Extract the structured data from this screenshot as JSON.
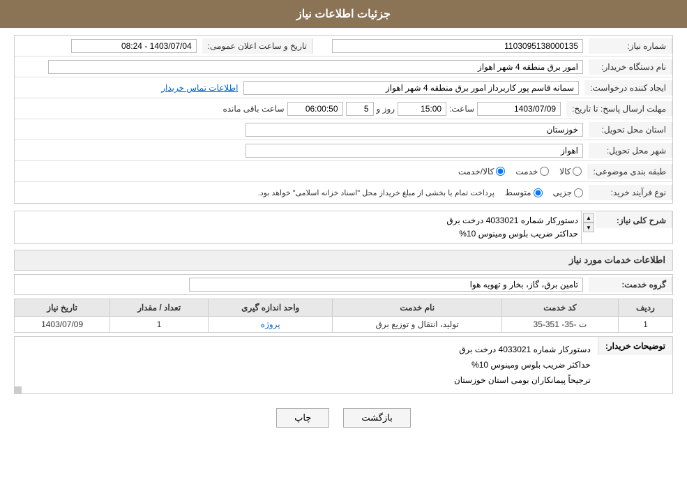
{
  "header": {
    "title": "جزئیات اطلاعات نیاز"
  },
  "form": {
    "need_number_label": "شماره نیاز:",
    "need_number_value": "1103095138000135",
    "buyer_org_label": "نام دستگاه خریدار:",
    "buyer_org_value": "امور برق منطقه 4 شهر اهواز",
    "creator_label": "ایجاد کننده درخواست:",
    "creator_value": "سمانه قاسم پور کاربرداز امور برق منطقه 4 شهر اهواز",
    "creator_link": "اطلاعات تماس خریدار",
    "deadline_label": "مهلت ارسال پاسخ: تا تاریخ:",
    "deadline_date": "1403/07/09",
    "deadline_time_label": "ساعت:",
    "deadline_time": "15:00",
    "deadline_days_label": "روز و",
    "deadline_days": "5",
    "deadline_remaining_label": "ساعت باقی مانده",
    "deadline_remaining": "06:00:50",
    "province_label": "استان محل تحویل:",
    "province_value": "خوزستان",
    "city_label": "شهر محل تحویل:",
    "city_value": "اهواز",
    "announce_date_label": "تاریخ و ساعت اعلان عمومی:",
    "announce_date_value": "1403/07/04 - 08:24",
    "category_label": "طبقه بندی موضوعی:",
    "category_options": [
      "کالا",
      "خدمت",
      "کالا/خدمت"
    ],
    "category_selected": "کالا",
    "purchase_type_label": "نوع فرآیند خرید:",
    "purchase_types": [
      "جزیی",
      "متوسط"
    ],
    "purchase_note": "پرداخت تمام یا بخشی از مبلغ خریداز محل \"اسناد خزانه اسلامی\" خواهد بود.",
    "description_label": "شرح کلی نیاز:",
    "description_text": "دستورکار شماره 4033021 درخت برق\nحداکثر ضریب بلوس ومینوس 10%",
    "services_section_title": "اطلاعات خدمات مورد نیاز",
    "service_group_label": "گروه خدمت:",
    "service_group_value": "تامین برق، گاز، بخار و تهویه هوا",
    "table": {
      "columns": [
        "ردیف",
        "کد خدمت",
        "نام خدمت",
        "واحد اندازه گیری",
        "تعداد / مقدار",
        "تاریخ نیاز"
      ],
      "rows": [
        {
          "row": "1",
          "code": "ت -35- 351-35",
          "name": "تولید، انتقال و توزیع برق",
          "unit": "پروژه",
          "qty": "1",
          "date": "1403/07/09"
        }
      ]
    },
    "buyer_notes_label": "توضیحات خریدار:",
    "buyer_notes_text": "دستورکار شماره 4033021 درخت برق\nحداکثر ضریب بلوس ومینوس 10%\nترجیحاً پیمانکاران بومی استان خوزستان"
  },
  "buttons": {
    "print": "چاپ",
    "back": "بازگشت"
  }
}
